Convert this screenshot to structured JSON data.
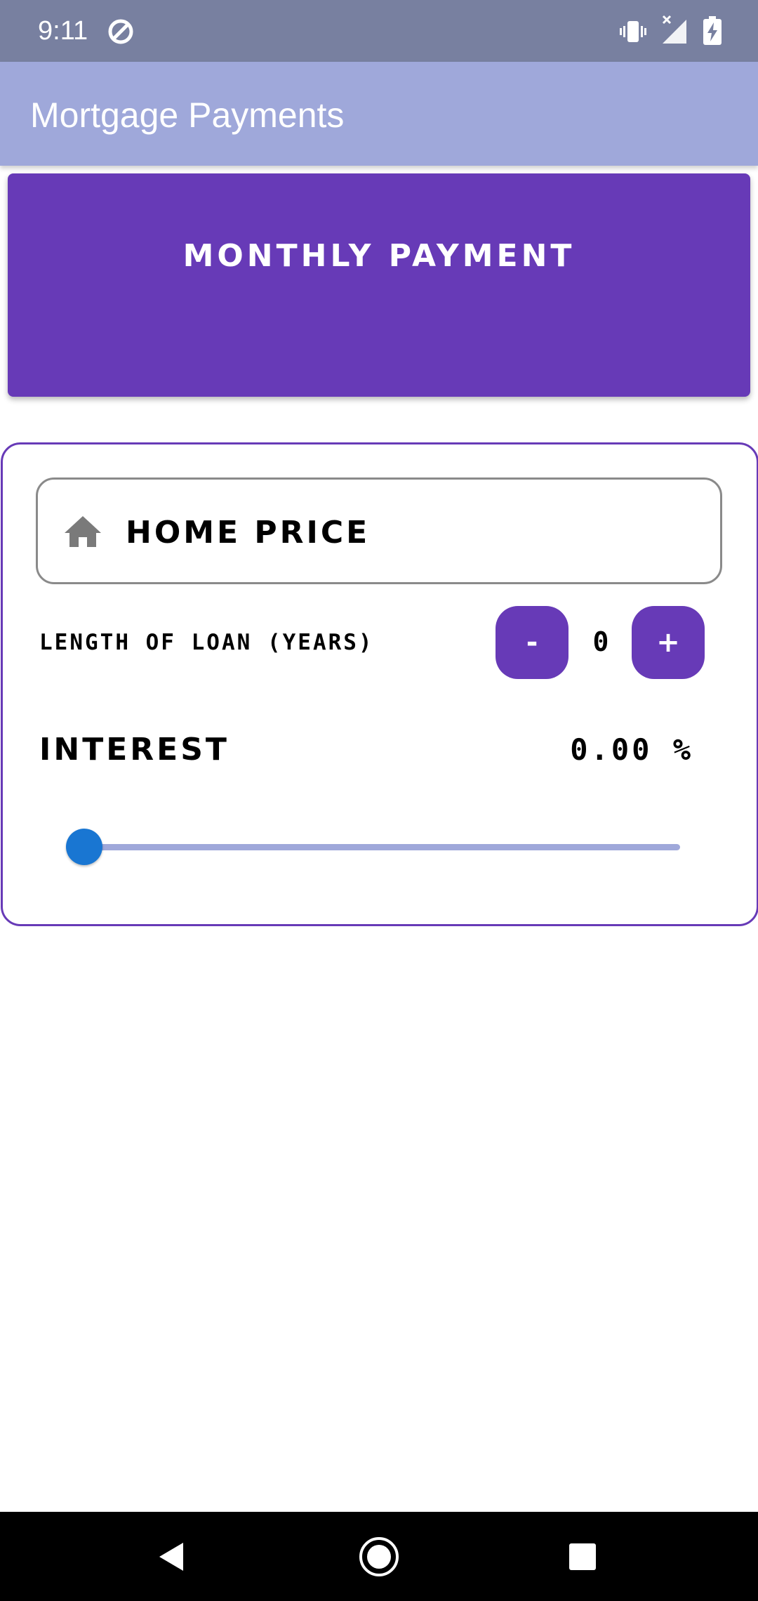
{
  "status_bar": {
    "time": "9:11",
    "icons": [
      "do-not-disturb-icon",
      "vibrate-icon",
      "no-signal-icon",
      "battery-charging-icon"
    ]
  },
  "app_bar": {
    "title": "Mortgage Payments",
    "color": "#9fa8da"
  },
  "payment_card": {
    "label": "MONTHLY PAYMENT",
    "color": "#673ab7"
  },
  "home_price": {
    "icon": "home-icon",
    "placeholder": "HOME PRICE",
    "value": ""
  },
  "loan_length": {
    "label": "LENGTH OF LOAN (YEARS)",
    "decrement_label": "-",
    "value": "0",
    "increment_label": "+"
  },
  "interest": {
    "label": "INTEREST",
    "value": "0.00 %",
    "slider_fraction": 0
  },
  "nav_bar": {
    "icons": [
      "back-icon",
      "home-circle-icon",
      "recents-icon"
    ]
  },
  "colors": {
    "accent": "#673ab7",
    "slider_thumb": "#1976d2",
    "slider_track": "#9fa8da",
    "status_bar": "#7880a0"
  }
}
